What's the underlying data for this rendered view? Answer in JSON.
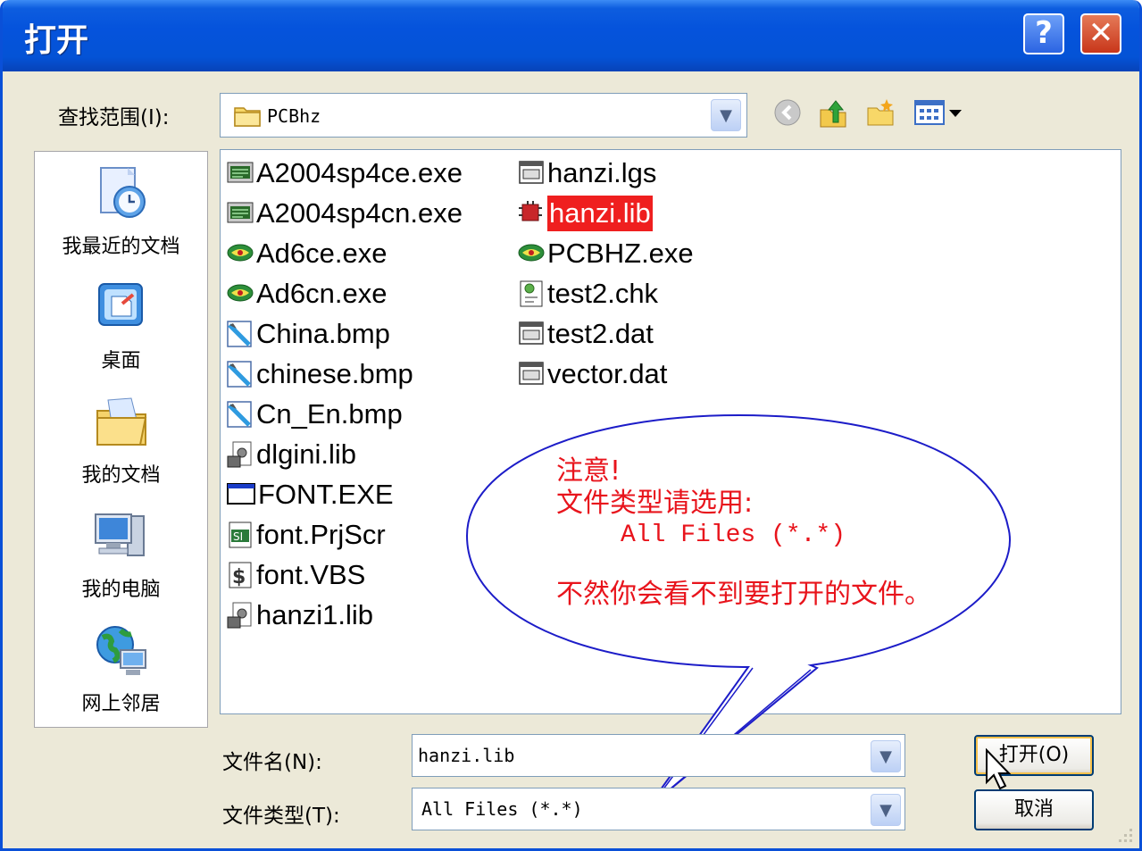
{
  "dialog": {
    "title": "打开",
    "help_glyph": "?",
    "close_glyph": "✕"
  },
  "look_in": {
    "label": "查找范围(I):",
    "value": "PCBhz"
  },
  "places": [
    {
      "label": "我最近的文档",
      "icon": "recent-documents-icon"
    },
    {
      "label": "桌面",
      "icon": "desktop-icon"
    },
    {
      "label": "我的文档",
      "icon": "my-documents-icon"
    },
    {
      "label": "我的电脑",
      "icon": "my-computer-icon"
    },
    {
      "label": "网上邻居",
      "icon": "network-places-icon"
    }
  ],
  "files_col1": [
    {
      "name": "A2004sp4ce.exe",
      "icon": "installer-exe-icon"
    },
    {
      "name": "A2004sp4cn.exe",
      "icon": "installer-exe-icon"
    },
    {
      "name": "Ad6ce.exe",
      "icon": "protel-exe-icon"
    },
    {
      "name": "Ad6cn.exe",
      "icon": "protel-exe-icon"
    },
    {
      "name": "China.bmp",
      "icon": "bitmap-icon"
    },
    {
      "name": "chinese.bmp",
      "icon": "bitmap-icon"
    },
    {
      "name": "Cn_En.bmp",
      "icon": "bitmap-icon"
    },
    {
      "name": "dlgini.lib",
      "icon": "lib-file-icon"
    },
    {
      "name": "FONT.EXE",
      "icon": "window-exe-icon"
    },
    {
      "name": "font.PrjScr",
      "icon": "script-project-icon"
    },
    {
      "name": "font.VBS",
      "icon": "vbs-script-icon"
    },
    {
      "name": "hanzi1.lib",
      "icon": "lib-file-icon"
    }
  ],
  "files_col2": [
    {
      "name": "hanzi.lgs",
      "icon": "data-file-icon"
    },
    {
      "name": "hanzi.lib",
      "icon": "component-lib-icon",
      "selected": true
    },
    {
      "name": "PCBHZ.exe",
      "icon": "protel-exe-icon"
    },
    {
      "name": "test2.chk",
      "icon": "check-file-icon"
    },
    {
      "name": "test2.dat",
      "icon": "data-file-icon"
    },
    {
      "name": "vector.dat",
      "icon": "data-file-icon"
    }
  ],
  "callout": {
    "line1": "注意!",
    "line2": "文件类型请选用:",
    "line3": "All Files (*.*)",
    "line4": "不然你会看不到要打开的文件。"
  },
  "filename": {
    "label": "文件名(N):",
    "value": "hanzi.lib"
  },
  "filetype": {
    "label": "文件类型(T):",
    "value": "All Files (*.*)"
  },
  "buttons": {
    "open": "打开(O)",
    "cancel": "取消"
  },
  "colors": {
    "title_bar": "#0553dc",
    "selection": "#ef1f1f",
    "annotation": "#e8141c",
    "callout_outline": "#1c1cc8"
  }
}
